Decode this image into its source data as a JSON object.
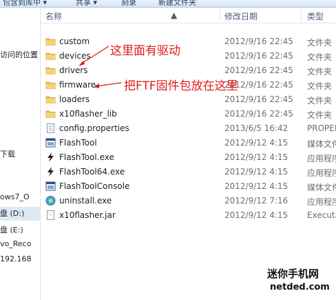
{
  "toolbar": {
    "items": [
      "包含到库中 ▾",
      "共享 ▾",
      "刻录",
      "新建文件夹"
    ]
  },
  "nav": {
    "items": [
      "访问的位置",
      "下载",
      "ows7_O",
      "盘 (D:)",
      "盘 (E:)",
      "vo_Reco",
      "192.168"
    ]
  },
  "columns": {
    "name": "名称",
    "date": "修改日期",
    "type": "类型"
  },
  "files": [
    {
      "name": "custom",
      "date": "2012/9/16 22:45",
      "type": "文件夹",
      "icon": "folder-icon"
    },
    {
      "name": "devices",
      "date": "2012/9/16 22:45",
      "type": "文件夹",
      "icon": "folder-icon"
    },
    {
      "name": "drivers",
      "date": "2012/9/16 22:45",
      "type": "文件夹",
      "icon": "folder-icon"
    },
    {
      "name": "firmware",
      "date": "2012/9/16 22:45",
      "type": "文件夹",
      "icon": "folder-icon"
    },
    {
      "name": "loaders",
      "date": "2012/9/16 22:45",
      "type": "文件夹",
      "icon": "folder-icon"
    },
    {
      "name": "x10flasher_lib",
      "date": "2012/9/16 22:45",
      "type": "文件夹",
      "icon": "folder-icon"
    },
    {
      "name": "config.properties",
      "date": "2013/6/5 16:42",
      "type": "PROPER",
      "icon": "properties-file-icon"
    },
    {
      "name": "FlashTool",
      "date": "2012/9/12 4:15",
      "type": "媒体文件",
      "icon": "media-file-icon"
    },
    {
      "name": "FlashTool.exe",
      "date": "2012/9/12 4:15",
      "type": "应用程序",
      "icon": "flash-exe-icon"
    },
    {
      "name": "FlashTool64.exe",
      "date": "2012/9/12 4:15",
      "type": "应用程序",
      "icon": "flash-exe-icon"
    },
    {
      "name": "FlashToolConsole",
      "date": "2012/9/12 4:15",
      "type": "媒体文件",
      "icon": "media-file-icon"
    },
    {
      "name": "uninstall.exe",
      "date": "2012/9/12 7:16",
      "type": "应用程序",
      "icon": "uninstall-icon"
    },
    {
      "name": "x10flasher.jar",
      "date": "2012/9/12 4:15",
      "type": "Executa",
      "icon": "jar-file-icon"
    }
  ],
  "annotations": {
    "drivers_note": "这里面有驱动",
    "firmware_note": "把FTF固件包放在这里"
  },
  "watermark": {
    "line1": "迷你手机网",
    "line2": "netded.com"
  },
  "colors": {
    "annotation": "#e11a1a",
    "folder": "#e7bf4f",
    "header_text": "#4c607a"
  }
}
